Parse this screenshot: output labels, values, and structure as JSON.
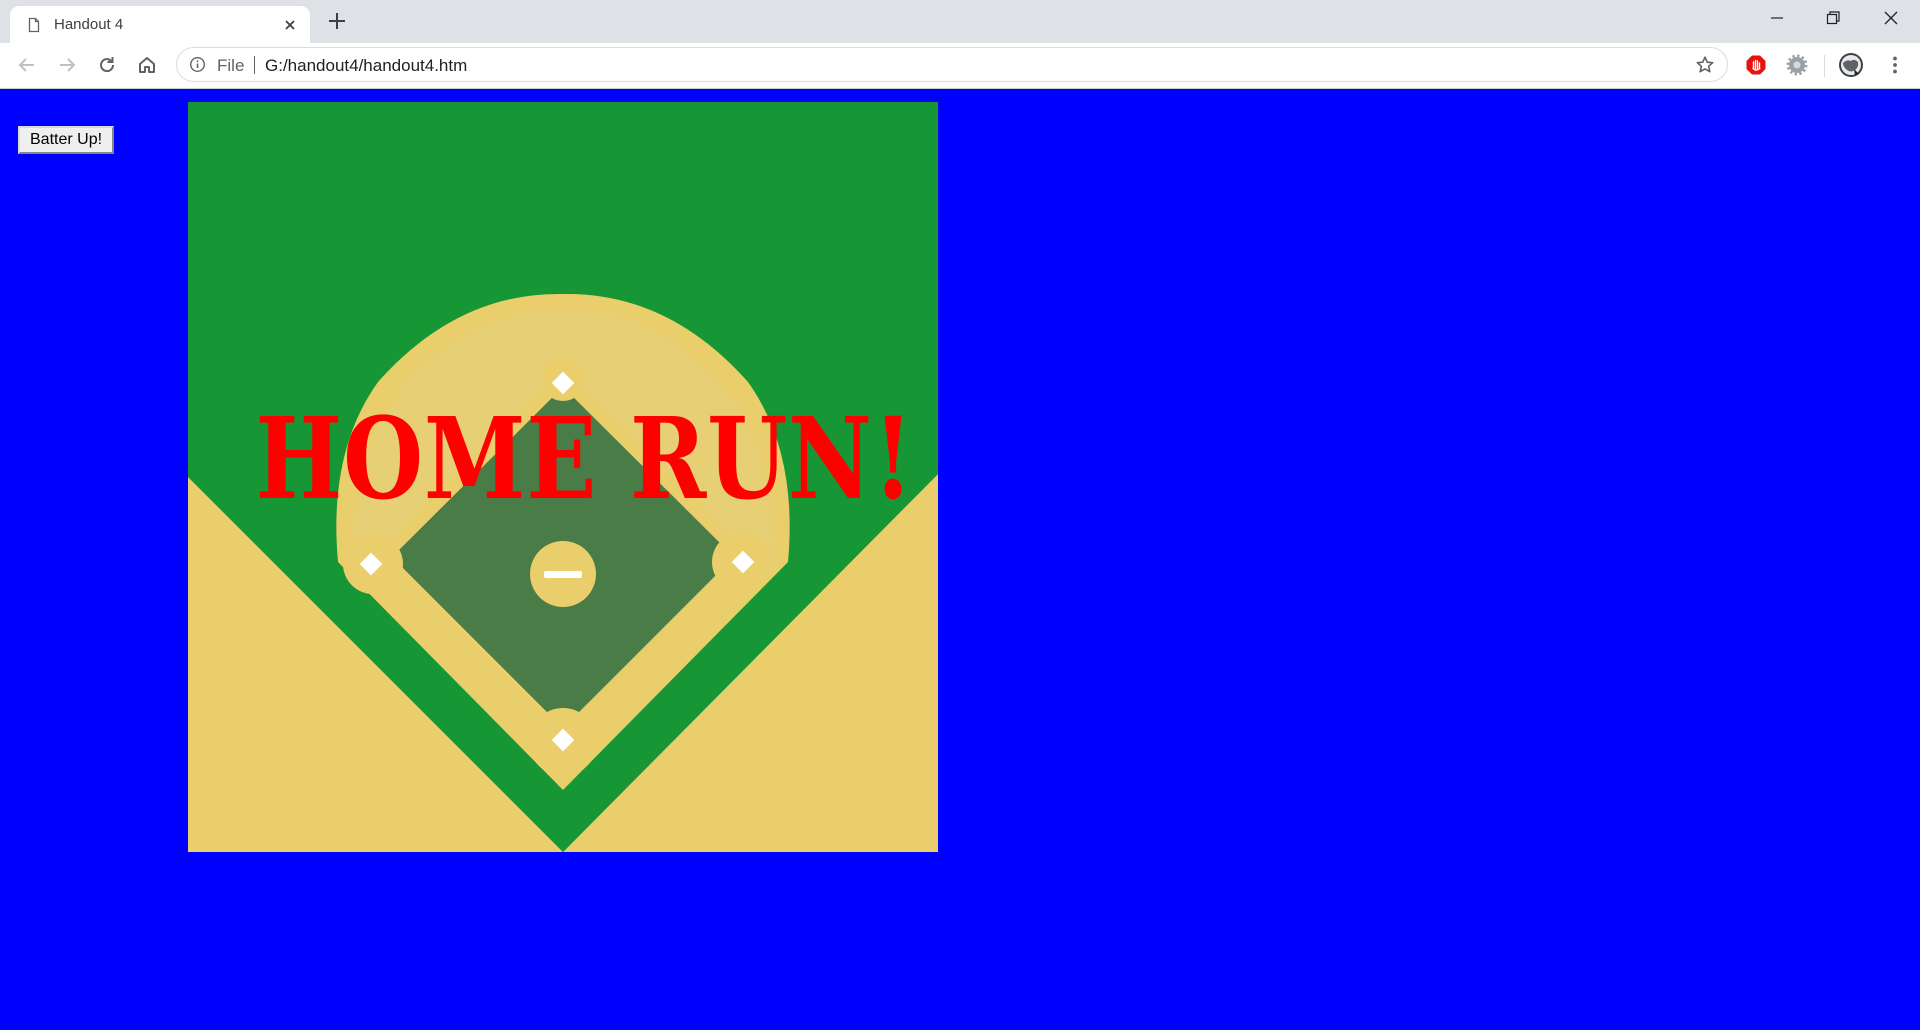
{
  "browser": {
    "tab": {
      "title": "Handout 4",
      "icon": "file-icon"
    },
    "address_bar": {
      "scheme_label": "File",
      "url": "G:/handout4/handout4.htm",
      "icon": "info-icon"
    },
    "icons": [
      "back-arrow-icon",
      "forward-arrow-icon",
      "reload-icon",
      "home-icon",
      "star-icon",
      "extension-icon",
      "gear-icon",
      "avatar-icon",
      "kebab-menu-icon",
      "minimize-icon",
      "restore-icon",
      "close-icon",
      "plus-icon"
    ]
  },
  "page": {
    "background_color": "#0000FF",
    "batter_button_label": "Batter Up!",
    "overlay_text": "HOME RUN!",
    "overlay_color": "#FF0000",
    "field_colors": {
      "grass": "#169634",
      "infield": "#4A7C47",
      "dirt": "#E9CE6B",
      "bases": "#FFFFFF"
    }
  }
}
